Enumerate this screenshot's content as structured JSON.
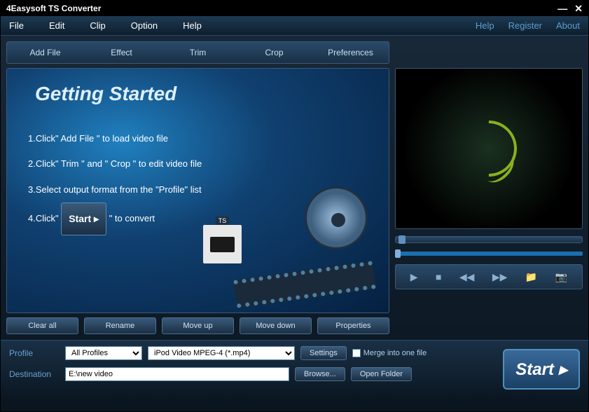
{
  "window": {
    "title": "4Easysoft TS Converter"
  },
  "menu": {
    "left": [
      "File",
      "Edit",
      "Clip",
      "Option",
      "Help"
    ],
    "right": [
      "Help",
      "Register",
      "About"
    ]
  },
  "toolbar": [
    "Add File",
    "Effect",
    "Trim",
    "Crop",
    "Preferences"
  ],
  "getting_started": {
    "heading": "Getting Started",
    "step1": "1.Click\" Add File \" to load video file",
    "step2": "2.Click\" Trim \" and \" Crop \" to edit video file",
    "step3": "3.Select output format from the \"Profile\" list",
    "step4_pre": "4.Click\"",
    "step4_btn": "Start ▸",
    "step4_post": "\" to convert",
    "ts_label": "TS"
  },
  "buttons": {
    "clear_all": "Clear all",
    "rename": "Rename",
    "move_up": "Move up",
    "move_down": "Move down",
    "properties": "Properties"
  },
  "bottom": {
    "profile_label": "Profile",
    "profile_filter": "All Profiles",
    "profile_value": "iPod Video MPEG-4 (*.mp4)",
    "settings": "Settings",
    "merge": "Merge into one file",
    "destination_label": "Destination",
    "destination_value": "E:\\new video",
    "browse": "Browse...",
    "open_folder": "Open Folder",
    "start": "Start ▸"
  }
}
